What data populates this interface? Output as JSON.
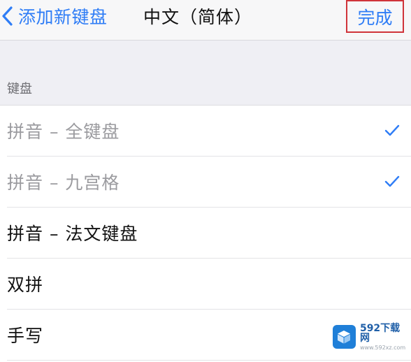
{
  "nav": {
    "back_label": "添加新键盘",
    "title": "中文（简体）",
    "done_label": "完成",
    "accent_color": "#2f7df6",
    "highlight_color": "#d0343a"
  },
  "section": {
    "header": "键盘"
  },
  "keyboards": [
    {
      "label": "拼音 – 全键盘",
      "checked": true,
      "enabled": false
    },
    {
      "label": "拼音 – 九宫格",
      "checked": true,
      "enabled": false
    },
    {
      "label": "拼音 – 法文键盘",
      "checked": false,
      "enabled": true
    },
    {
      "label": "双拼",
      "checked": false,
      "enabled": true
    },
    {
      "label": "手写",
      "checked": false,
      "enabled": true
    }
  ],
  "watermark": {
    "brand": "592下载网",
    "url": "www.592xz.com"
  },
  "icons": {
    "back": "chevron-left-icon",
    "check": "checkmark-icon",
    "watermark_logo": "cube-icon"
  }
}
